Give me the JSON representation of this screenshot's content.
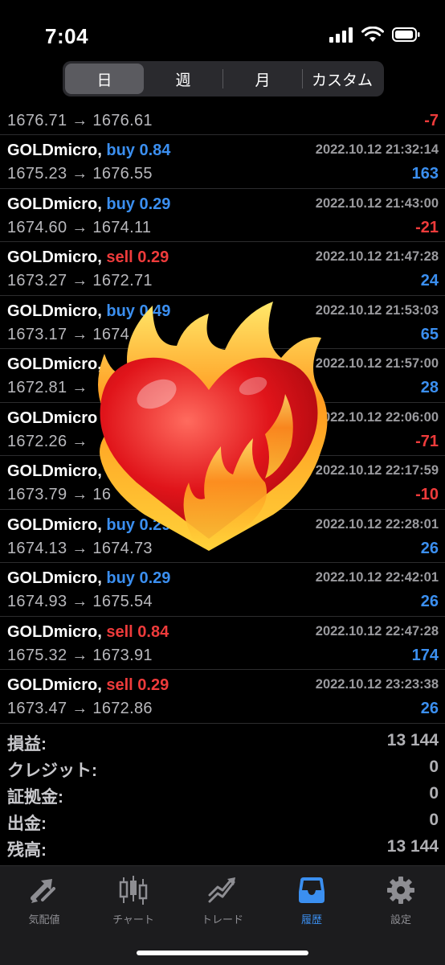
{
  "status_bar": {
    "time": "7:04"
  },
  "segments": [
    {
      "label": "日",
      "active": true
    },
    {
      "label": "週",
      "active": false
    },
    {
      "label": "月",
      "active": false
    },
    {
      "label": "カスタム",
      "active": false
    }
  ],
  "deals": [
    {
      "prices": "1676.71 → 1676.61",
      "pl": "-7"
    },
    {
      "symbol": "GOLDmicro,",
      "side": "buy 0.84",
      "datetime": "2022.10.12 21:32:14",
      "prices": "1675.23 → 1676.55",
      "pl": "163"
    },
    {
      "symbol": "GOLDmicro,",
      "side": "buy 0.29",
      "datetime": "2022.10.12 21:43:00",
      "prices": "1674.60 → 1674.11",
      "pl": "-21"
    },
    {
      "symbol": "GOLDmicro,",
      "side": "sell 0.29",
      "datetime": "2022.10.12 21:47:28",
      "prices": "1673.27 → 1672.71",
      "pl": "24"
    },
    {
      "symbol": "GOLDmicro,",
      "side": "buy 0.49",
      "datetime": "2022.10.12 21:53:03",
      "prices": "1673.17 → 1674.0",
      "pl": "65"
    },
    {
      "symbol": "GOLDmicro,",
      "side": "",
      "datetime": "2022.10.12 21:57:00",
      "prices": "1672.81 →",
      "pl": "28"
    },
    {
      "symbol": "GOLDmicro",
      "side": "",
      "datetime": "2022.10.12 22:06:00",
      "prices": "1672.26 →",
      "pl": "-71"
    },
    {
      "symbol": "GOLDmicro,",
      "side": "",
      "datetime": "2022.10.12 22:17:59",
      "prices": "1673.79 → 16",
      "pl": "-10"
    },
    {
      "symbol": "GOLDmicro,",
      "side": "buy 0.29",
      "datetime": "2022.10.12 22:28:01",
      "prices": "1674.13 → 1674.73",
      "pl": "26"
    },
    {
      "symbol": "GOLDmicro,",
      "side": "buy 0.29",
      "datetime": "2022.10.12 22:42:01",
      "prices": "1674.93 → 1675.54",
      "pl": "26"
    },
    {
      "symbol": "GOLDmicro,",
      "side": "sell 0.84",
      "datetime": "2022.10.12 22:47:28",
      "prices": "1675.32 → 1673.91",
      "pl": "174"
    },
    {
      "symbol": "GOLDmicro,",
      "side": "sell 0.29",
      "datetime": "2022.10.12 23:23:38",
      "prices": "1673.47 → 1672.86",
      "pl": "26"
    }
  ],
  "summary": [
    {
      "label": "損益:",
      "value": "13 144"
    },
    {
      "label": "クレジット:",
      "value": "0"
    },
    {
      "label": "証拠金:",
      "value": "0"
    },
    {
      "label": "出金:",
      "value": "0"
    },
    {
      "label": "残高:",
      "value": "13 144"
    }
  ],
  "tabs": [
    {
      "label": "気配値",
      "icon": "quotes-arrows-icon",
      "active": false
    },
    {
      "label": "チャート",
      "icon": "candlestick-chart-icon",
      "active": false
    },
    {
      "label": "トレード",
      "icon": "trade-trend-icon",
      "active": false
    },
    {
      "label": "履歴",
      "icon": "history-tray-icon",
      "active": true
    },
    {
      "label": "設定",
      "icon": "gear-icon",
      "active": false
    }
  ],
  "colors": {
    "buy": "#3b8ff0",
    "sell": "#ee3b3b",
    "active_tab": "#3b8ff0"
  },
  "sticker": {
    "icon": "heart-on-fire-emoji"
  }
}
